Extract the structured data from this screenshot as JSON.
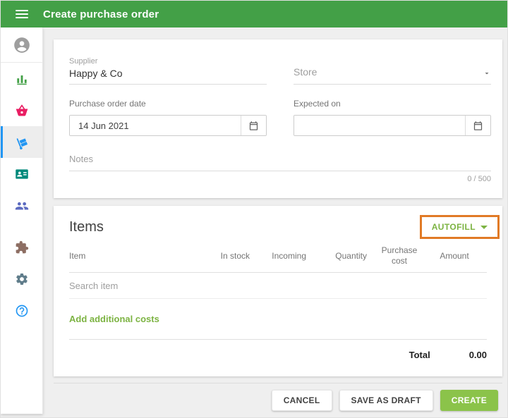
{
  "header": {
    "title": "Create purchase order"
  },
  "sidebar": {
    "icons": [
      "profile",
      "reports",
      "sales",
      "purchase-orders",
      "contacts",
      "employees",
      "integrations",
      "settings",
      "help"
    ],
    "selected": "purchase-orders"
  },
  "form": {
    "supplier": {
      "label": "Supplier",
      "value": "Happy & Co"
    },
    "store": {
      "label": "Store"
    },
    "purchase_order_date": {
      "label": "Purchase order date",
      "value": "14 Jun 2021"
    },
    "expected_on": {
      "label": "Expected on",
      "value": ""
    },
    "notes": {
      "placeholder": "Notes",
      "counter": "0 / 500"
    }
  },
  "items": {
    "title": "Items",
    "autofill_label": "AUTOFILL",
    "columns": [
      "Item",
      "In stock",
      "Incoming",
      "Quantity",
      "Purchase cost",
      "Amount"
    ],
    "search_placeholder": "Search item",
    "add_costs_label": "Add additional costs",
    "total_label": "Total",
    "total_value": "0.00"
  },
  "actions": {
    "cancel": "CANCEL",
    "save_draft": "SAVE AS DRAFT",
    "create": "CREATE"
  },
  "colors": {
    "header_green": "#43A047",
    "accent_green": "#7CB342",
    "create_button_green": "#8BC34A",
    "highlight_orange": "#E17A26",
    "selected_blue": "#2196F3"
  }
}
